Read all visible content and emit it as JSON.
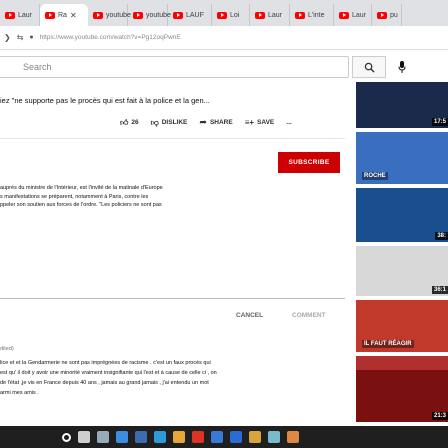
{
  "browser": {
    "tabs": [
      {
        "label": "Laur",
        "active": false
      },
      {
        "label": "Ra",
        "active": true
      },
      {
        "label": "youtube",
        "active": false
      },
      {
        "label": "youtube",
        "active": false
      },
      {
        "label": "LAUF",
        "active": false
      },
      {
        "label": "Loi",
        "active": false
      },
      {
        "label": "Laur",
        "active": false
      },
      {
        "label": "L'inte",
        "active": false
      },
      {
        "label": "Laur",
        "active": false
      },
      {
        "label": "pu",
        "active": false
      }
    ],
    "url": "https://www.youtube.com/watch?v=Pg12oqPwnE"
  },
  "search": {
    "placeholder": "Search"
  },
  "video": {
    "title": "iez \"ne supporte pas le procès qui est fait à la police et la gen...",
    "likes": "26",
    "dislike_label": "DISLIKE",
    "share_label": "SHARE",
    "save_label": "SAVE",
    "more": "..."
  },
  "channel": {
    "subscribe_label": "SUBSCRIBE"
  },
  "description": {
    "lines": [
      "auprès du ministre de l'Intérieur, est l'invité de la matinale d'Europe",
      "s manifestations se préparent, notamment à Paris, contre les",
      "ppeler son soutien aux forces de l'ordre. \"Les policiers ne sont pas"
    ]
  },
  "comment_box": {
    "cancel_label": "CANCEL",
    "comment_label": "COMMENT"
  },
  "comment": {
    "edited": "dited)",
    "lines": [
      "lice et et la Gendarmerie ne sont pas imprégnées de racisme . c'est un faux procès qui",
      "est qu' il doit y avoir une minorité vraiment insignifiante qui l'est et à cause de celle ci , on",
      "de l'état ,je vis en France depuis 40 ans , jamais au grand jamais , j'ai entendu un mot",
      "armi mes amis ."
    ]
  },
  "sidebar": {
    "thumbnails": [
      {
        "duration": "17:5",
        "color": "#1b2a4a"
      },
      {
        "duration": "",
        "color": "#3a6fc0",
        "overlay": "ROCHE"
      },
      {
        "duration": "38:",
        "color": "#1a4f8f"
      },
      {
        "duration": "36:1",
        "color": "#d8d8d8"
      },
      {
        "duration": "",
        "color": "#c0392b",
        "overlay": "IL FAUT RÉAGIR"
      },
      {
        "duration": "40:4",
        "color": "#b03030"
      },
      {
        "duration": "21:3",
        "color": "#7a1010"
      }
    ]
  },
  "taskbar": {
    "icons": [
      "windows-icon",
      "search-icon",
      "task-view-icon",
      "explorer-icon",
      "store-icon",
      "edge-icon",
      "chrome-icon",
      "opera-icon",
      "mail-icon",
      "dropbox-icon",
      "folder-icon",
      "app-icon",
      "office-icon"
    ]
  }
}
